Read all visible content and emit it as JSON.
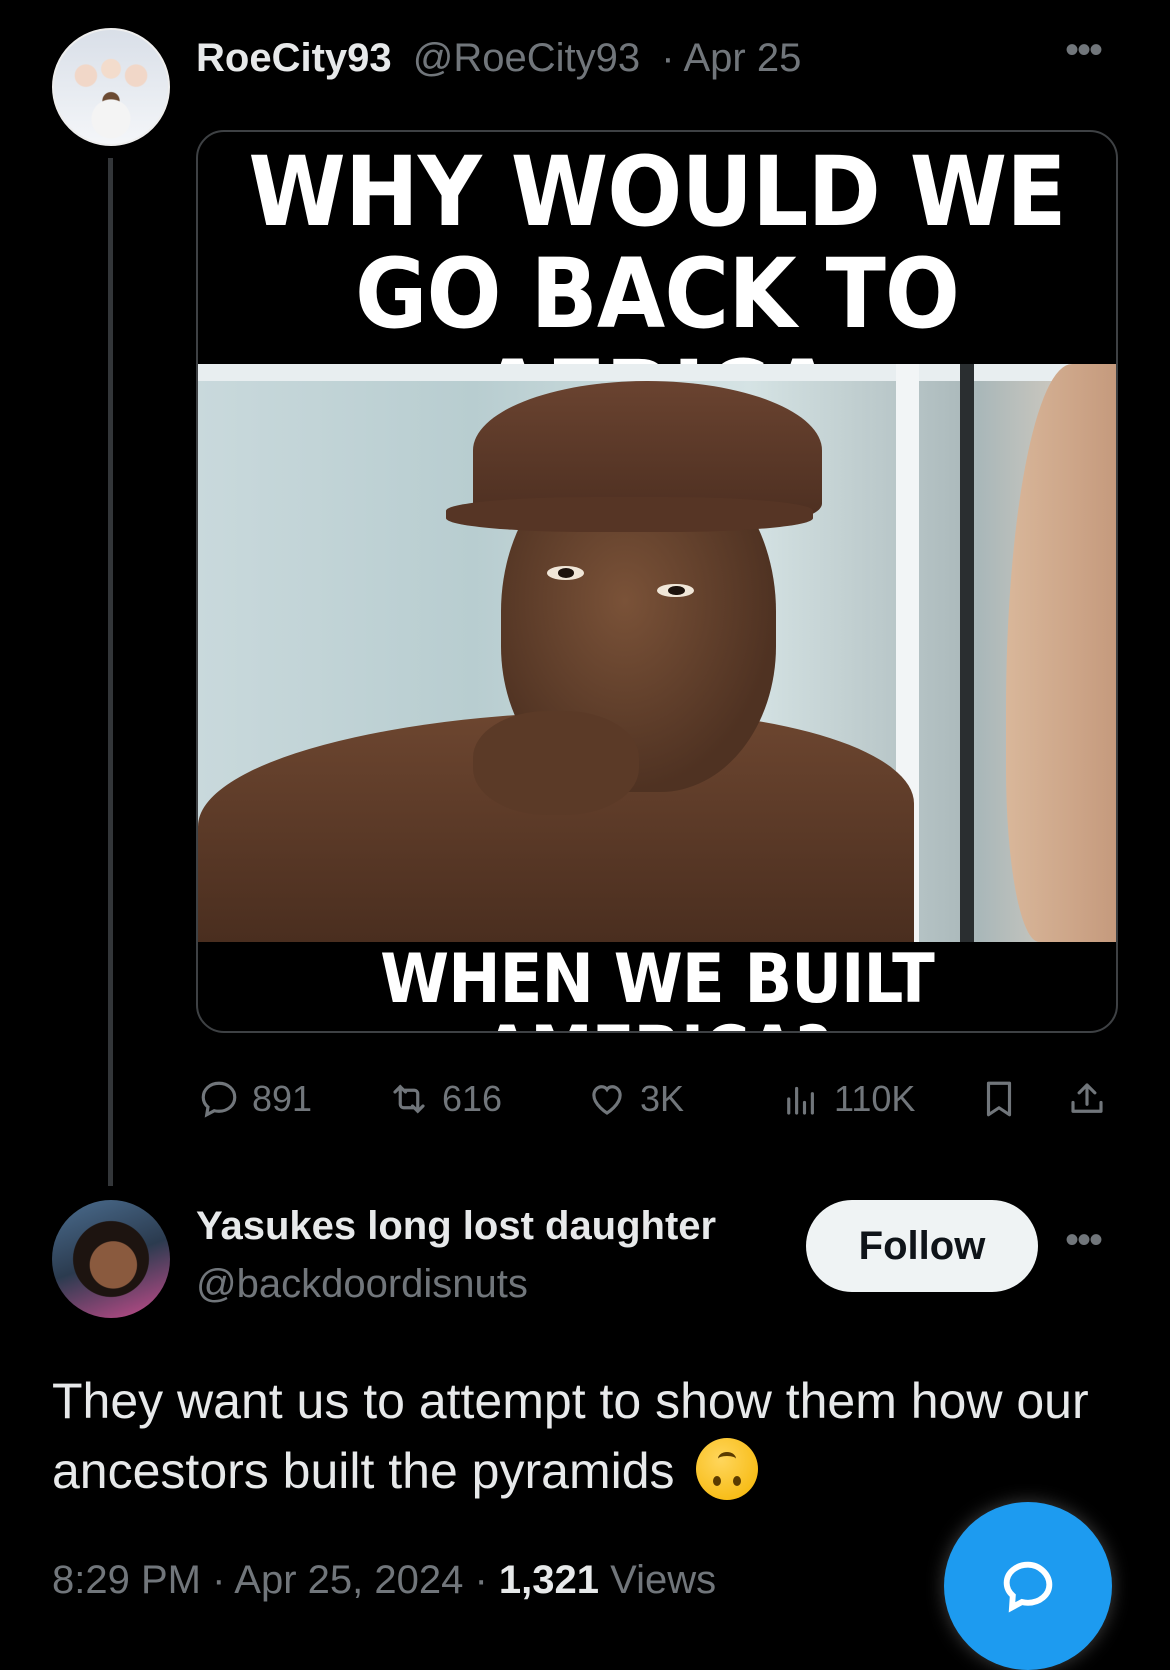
{
  "tweet": {
    "author_name": "RoeCity93",
    "author_handle": "@RoeCity93",
    "date": "· Apr 25",
    "more_label": "•••",
    "meme": {
      "top_text": "WHY WOULD WE GO BACK TO AFRICA",
      "bottom_text": "WHEN WE BUILT AMERICA?"
    },
    "stats": {
      "replies": "891",
      "reposts": "616",
      "likes": "3K",
      "views": "110K"
    }
  },
  "reply": {
    "author_name": "Yasukes long lost daughter",
    "author_handle": "@backdoordisnuts",
    "follow_label": "Follow",
    "more_label": "•••",
    "text": "They want us to attempt to show them how our ancestors built the pyramids",
    "emoji": "upside-down-face",
    "time": "8:29 PM · Apr 25, 2024 · ",
    "views_count": "1,321",
    "views_label": " Views"
  },
  "colors": {
    "background": "#000000",
    "text": "#e7e9ea",
    "muted": "#71767b",
    "accent": "#1d9bf0"
  }
}
